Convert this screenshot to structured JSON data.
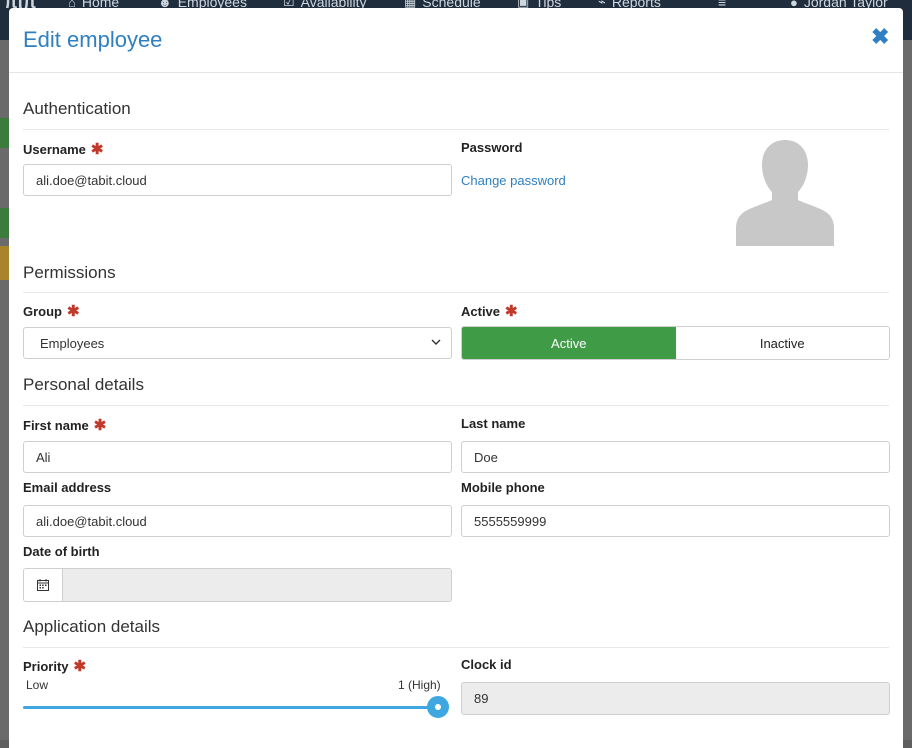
{
  "nav": {
    "items": [
      {
        "label": "Home",
        "icon": "home-icon"
      },
      {
        "label": "Employees",
        "icon": "users-icon"
      },
      {
        "label": "Availability",
        "icon": "check-square-icon"
      },
      {
        "label": "Schedule",
        "icon": "grid-icon"
      },
      {
        "label": "Tips",
        "icon": "camera-icon"
      },
      {
        "label": "Reports",
        "icon": "chart-icon"
      }
    ],
    "user": "Jordan Taylor"
  },
  "modal": {
    "title": "Edit employee",
    "close_icon": "close-icon"
  },
  "authentication": {
    "title": "Authentication",
    "username_label": "Username",
    "username_value": "ali.doe@tabit.cloud",
    "password_label": "Password",
    "change_password": "Change password"
  },
  "permissions": {
    "title": "Permissions",
    "group_label": "Group",
    "group_value": "Employees",
    "active_label": "Active",
    "active_option": "Active",
    "inactive_option": "Inactive",
    "selected": "Active"
  },
  "personal": {
    "title": "Personal details",
    "first_name_label": "First name",
    "first_name_value": "Ali",
    "last_name_label": "Last name",
    "last_name_value": "Doe",
    "email_label": "Email address",
    "email_value": "ali.doe@tabit.cloud",
    "mobile_label": "Mobile phone",
    "mobile_value": "5555559999",
    "dob_label": "Date of birth",
    "dob_value": "",
    "calendar_icon": "calendar-icon"
  },
  "application": {
    "title": "Application details",
    "priority_label": "Priority",
    "priority_min_label": "Low",
    "priority_max_label": "1 (High)",
    "priority_level": 1.0,
    "clock_id_label": "Clock id",
    "clock_id_value": "89"
  },
  "colors": {
    "accent": "#2f7fc1",
    "active_green": "#3f9b46",
    "required": "#c0392b",
    "slider": "#3fa7e0"
  }
}
